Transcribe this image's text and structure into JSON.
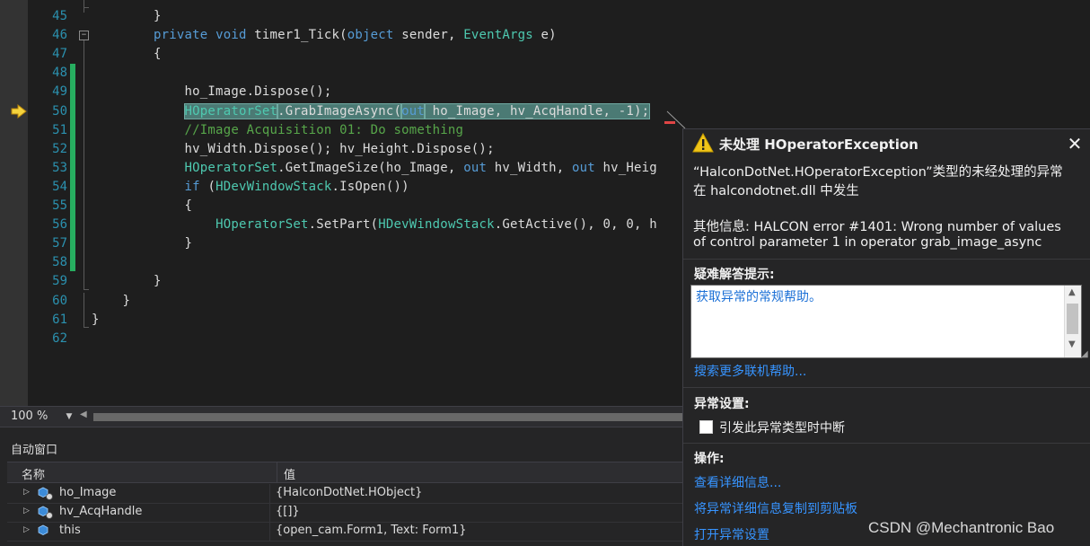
{
  "colors": {
    "keyword": "#569cd6",
    "type": "#4ec9b0",
    "comment": "#57a64a",
    "plain": "#dcdcdc",
    "number": "#b5cea8",
    "line_number": "#2b91af",
    "link": "#3794ff"
  },
  "editor": {
    "lines": [
      {
        "num": "45",
        "tokens": [
          {
            "t": "        }",
            "c": "plain"
          }
        ]
      },
      {
        "num": "46",
        "tokens": [
          {
            "t": "        ",
            "c": "plain"
          },
          {
            "t": "private",
            "c": "keyword"
          },
          {
            "t": " ",
            "c": "plain"
          },
          {
            "t": "void",
            "c": "keyword"
          },
          {
            "t": " timer1_Tick(",
            "c": "plain"
          },
          {
            "t": "object",
            "c": "keyword"
          },
          {
            "t": " sender, ",
            "c": "plain"
          },
          {
            "t": "EventArgs",
            "c": "type"
          },
          {
            "t": " e)",
            "c": "plain"
          }
        ]
      },
      {
        "num": "47",
        "tokens": [
          {
            "t": "        {",
            "c": "plain"
          }
        ]
      },
      {
        "num": "48",
        "tokens": []
      },
      {
        "num": "49",
        "tokens": [
          {
            "t": "            ho_Image.Dispose();",
            "c": "plain"
          }
        ]
      },
      {
        "num": "50",
        "tokens": [
          {
            "t": "            ",
            "c": "plain"
          },
          {
            "t": "HOperatorSet",
            "c": "type",
            "hl": true
          },
          {
            "t": ".GrabImageAsync(",
            "c": "plain",
            "hl": true
          },
          {
            "t": "out",
            "c": "keyword",
            "hl": true
          },
          {
            "t": " ho_Image, hv_AcqHandle, -1);",
            "c": "plain",
            "hl": true
          }
        ]
      },
      {
        "num": "51",
        "tokens": [
          {
            "t": "            ",
            "c": "plain"
          },
          {
            "t": "//Image Acquisition 01: Do something",
            "c": "comment"
          }
        ]
      },
      {
        "num": "52",
        "tokens": [
          {
            "t": "            hv_Width.Dispose(); hv_Height.Dispose();",
            "c": "plain"
          }
        ]
      },
      {
        "num": "53",
        "tokens": [
          {
            "t": "            ",
            "c": "plain"
          },
          {
            "t": "HOperatorSet",
            "c": "type"
          },
          {
            "t": ".GetImageSize(ho_Image, ",
            "c": "plain"
          },
          {
            "t": "out",
            "c": "keyword"
          },
          {
            "t": " hv_Width, ",
            "c": "plain"
          },
          {
            "t": "out",
            "c": "keyword"
          },
          {
            "t": " hv_Heig",
            "c": "plain"
          }
        ]
      },
      {
        "num": "54",
        "tokens": [
          {
            "t": "            ",
            "c": "plain"
          },
          {
            "t": "if",
            "c": "keyword"
          },
          {
            "t": " (",
            "c": "plain"
          },
          {
            "t": "HDevWindowStack",
            "c": "type"
          },
          {
            "t": ".IsOpen())",
            "c": "plain"
          }
        ]
      },
      {
        "num": "55",
        "tokens": [
          {
            "t": "            {",
            "c": "plain"
          }
        ]
      },
      {
        "num": "56",
        "tokens": [
          {
            "t": "                ",
            "c": "plain"
          },
          {
            "t": "HOperatorSet",
            "c": "type"
          },
          {
            "t": ".SetPart(",
            "c": "plain"
          },
          {
            "t": "HDevWindowStack",
            "c": "type"
          },
          {
            "t": ".GetActive(), 0, 0, h",
            "c": "plain"
          }
        ]
      },
      {
        "num": "57",
        "tokens": [
          {
            "t": "            }",
            "c": "plain"
          }
        ]
      },
      {
        "num": "58",
        "tokens": []
      },
      {
        "num": "59",
        "tokens": [
          {
            "t": "        }",
            "c": "plain"
          }
        ]
      },
      {
        "num": "60",
        "tokens": [
          {
            "t": "    }",
            "c": "plain"
          }
        ]
      },
      {
        "num": "61",
        "tokens": [
          {
            "t": "}",
            "c": "plain"
          }
        ]
      },
      {
        "num": "62",
        "tokens": []
      }
    ]
  },
  "zoom": {
    "value": "100 %"
  },
  "autos": {
    "title": "自动窗口",
    "col_name": "名称",
    "col_value": "值",
    "rows": [
      {
        "name": "ho_Image",
        "value": "{HalconDotNet.HObject}",
        "icon": "field-icon"
      },
      {
        "name": "hv_AcqHandle",
        "value": "{[]}",
        "icon": "field-icon"
      },
      {
        "name": "this",
        "value": "{open_cam.Form1, Text: Form1}",
        "icon": "object-icon"
      }
    ]
  },
  "popup": {
    "title": "未处理 HOperatorException",
    "exception_line1": "“HalconDotNet.HOperatorException”类型的未经处理的异常",
    "exception_line2": "在 halcondotnet.dll 中发生",
    "info_line1": "其他信息: HALCON error #1401: Wrong number of values",
    "info_line2": "of control parameter 1 in operator grab_image_async",
    "tips_heading": "疑难解答提示:",
    "tips_link": "获取异常的常规帮助。",
    "search_link": "搜索更多联机帮助...",
    "settings_heading": "异常设置:",
    "break_label": "引发此异常类型时中断",
    "actions_heading": "操作:",
    "actions": [
      "查看详细信息...",
      "将异常详细信息复制到剪贴板",
      "打开异常设置"
    ]
  },
  "watermark": "CSDN @Mechantronic Bao"
}
